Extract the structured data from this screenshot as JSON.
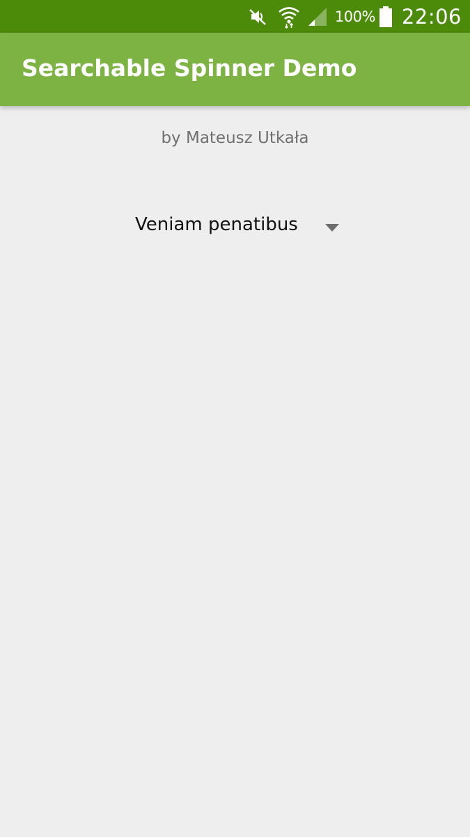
{
  "status_bar": {
    "battery_text": "100%",
    "time": "22:06",
    "icons": [
      "mute-icon",
      "wifi-icon",
      "signal-icon",
      "battery-icon"
    ],
    "background": "#4c8a0a"
  },
  "app_bar": {
    "title": "Searchable Spinner Demo",
    "background": "#7cb342"
  },
  "main": {
    "author": "by Mateusz Utkała",
    "spinner": {
      "selected_value": "Veniam penatibus",
      "icon": "dropdown-arrow-icon"
    }
  }
}
